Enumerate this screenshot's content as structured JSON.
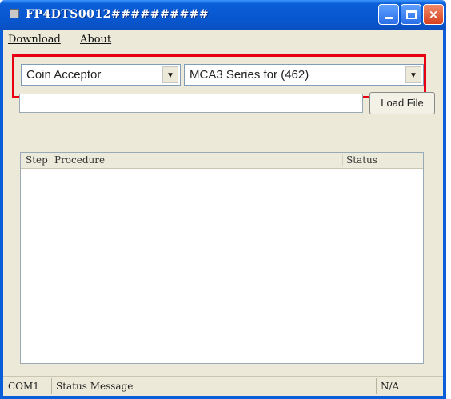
{
  "window": {
    "title": "FP4DTS0012##########",
    "controls": {
      "minimize": "minimize-icon",
      "maximize": "maximize-icon",
      "close": "×"
    }
  },
  "menu": {
    "items": [
      "Download",
      "About"
    ]
  },
  "selectors": {
    "device": {
      "selected": "Coin Acceptor"
    },
    "model": {
      "selected": "MCA3 Series for (462)"
    }
  },
  "file": {
    "path_value": "",
    "load_button": "Load File"
  },
  "procedure_list": {
    "columns": [
      "Step",
      "Procedure",
      "Status"
    ],
    "rows": []
  },
  "status_bar": {
    "port": "COM1",
    "message": "Status Message",
    "state": "N/A"
  },
  "colors": {
    "titlebar": "#0a5fd8",
    "highlight": "#e60012",
    "window_bg": "#ece9d8"
  }
}
